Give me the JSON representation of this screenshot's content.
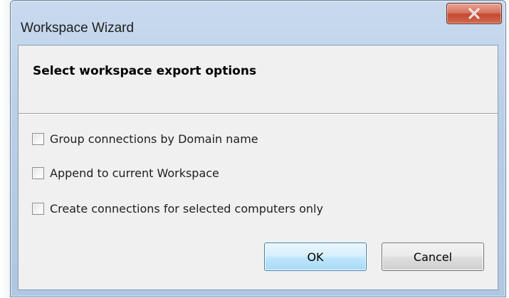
{
  "window": {
    "title": "Workspace Wizard"
  },
  "titlebar": {
    "close_icon": "close-icon"
  },
  "header": {
    "title": "Select workspace export options"
  },
  "options": [
    {
      "label": "Group connections by Domain name",
      "checked": false
    },
    {
      "label": "Append to current Workspace",
      "checked": false
    },
    {
      "label": "Create connections for selected computers only",
      "checked": false
    }
  ],
  "buttons": {
    "ok_label": "OK",
    "cancel_label": "Cancel"
  },
  "colors": {
    "close_button": "#c24a33",
    "ok_border": "#3c7fb1",
    "titlebar": "#b9cfe8"
  }
}
